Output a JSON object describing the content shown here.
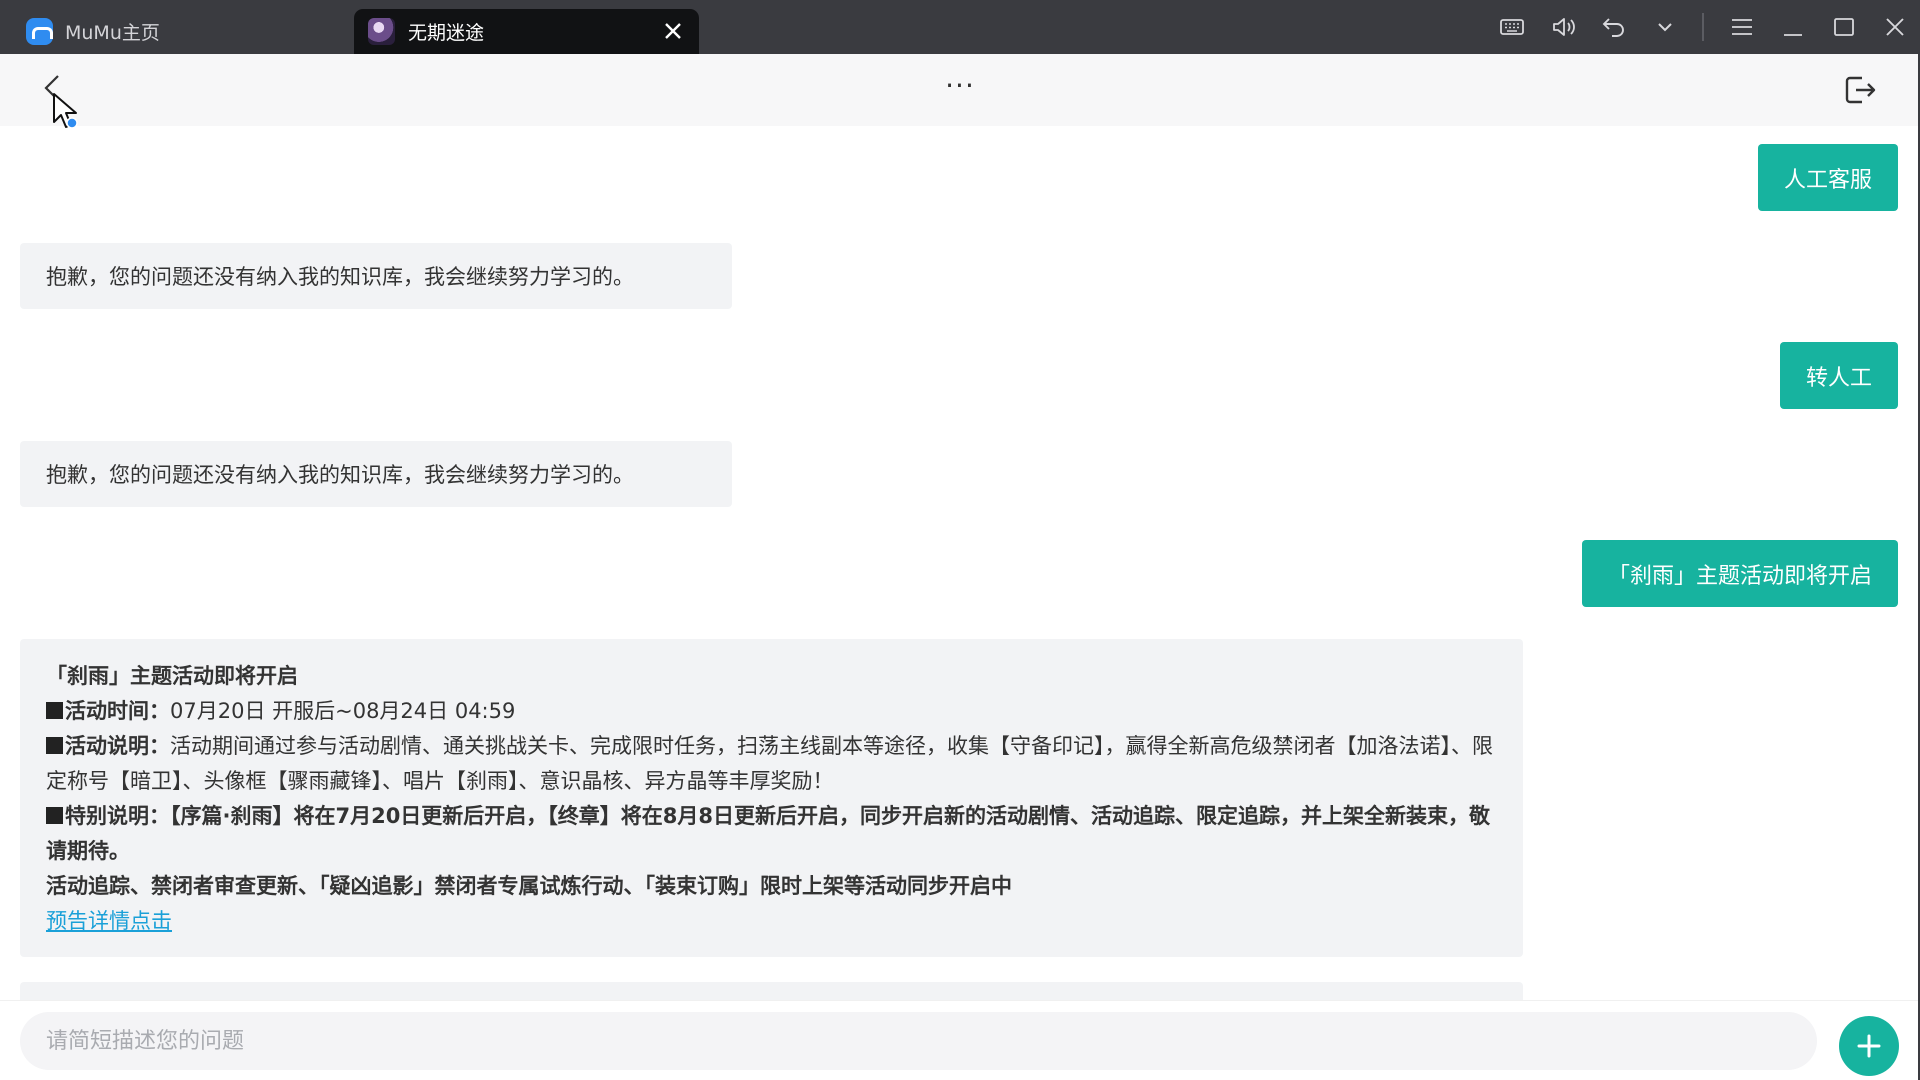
{
  "window": {
    "tabs": [
      {
        "label": "MuMu主页",
        "icon": "mumu-logo-icon"
      },
      {
        "label": "无期迷途",
        "icon": "game-avatar-icon",
        "active": true
      }
    ],
    "controls": [
      "keyboard-icon",
      "volume-icon",
      "undo-icon",
      "chevron-down-icon",
      "menu-icon",
      "minimize-icon",
      "maximize-icon",
      "close-icon"
    ]
  },
  "header": {
    "more_label": "···"
  },
  "messages": [
    {
      "role": "user",
      "text": "人工客服"
    },
    {
      "role": "bot",
      "text": "抱歉，您的问题还没有纳入我的知识库，我会继续努力学习的。"
    },
    {
      "role": "user",
      "text": "转人工"
    },
    {
      "role": "bot",
      "text": "抱歉，您的问题还没有纳入我的知识库，我会继续努力学习的。"
    },
    {
      "role": "user",
      "text": "「刹雨」主题活动即将开启"
    }
  ],
  "announcement": {
    "title": "「刹雨」主题活动即将开启",
    "time_label": "活动时间：",
    "time_value": "07月20日 开服后~08月24日 04:59",
    "desc_label": "活动说明：",
    "desc_value": "活动期间通过参与活动剧情、通关挑战关卡、完成限时任务，扫荡主线副本等途径，收集【守备印记】，赢得全新高危级禁闭者【加洛法诺】、限定称号【暗卫】、头像框【骤雨藏锋】、唱片【刹雨】、意识晶核、异方晶等丰厚奖励！",
    "special_label": "特别说明：",
    "special_value": "【序篇·刹雨】将在7月20日更新后开启，【终章】将在8月8日更新后开启，同步开启新的活动剧情、活动追踪、限定追踪，并上架全新装束，敬请期待。",
    "extra": "活动追踪、禁闭者审查更新、「疑凶追影」禁闭者专属试炼行动、「装束订购」限时上架等活动同步开启中",
    "link": "预告详情点击"
  },
  "input": {
    "placeholder": "请简短描述您的问题",
    "value": ""
  },
  "colors": {
    "accent": "#17b39f",
    "titlebar": "#3a3b40",
    "bubble_bot": "#f2f3f5",
    "link": "#1aa0d8"
  }
}
